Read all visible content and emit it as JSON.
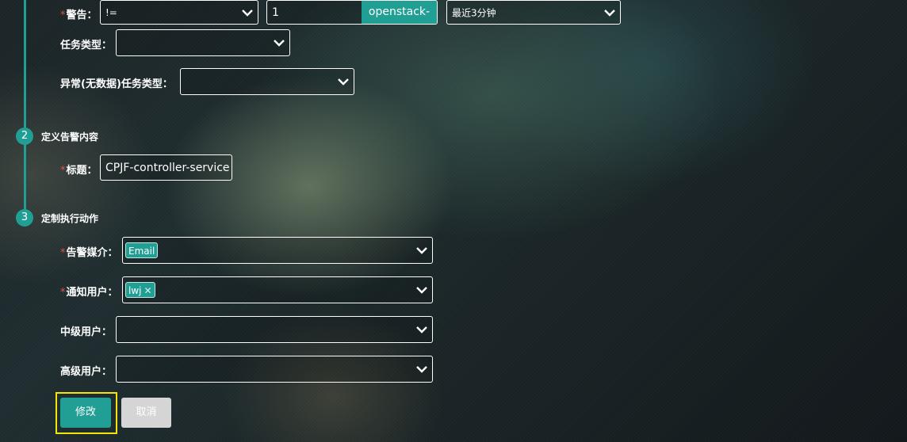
{
  "step1": {
    "alert": {
      "label": "警告：",
      "operator": "!=",
      "threshold": "1",
      "service_tag": "openstack-api",
      "time_range": "最近3分钟"
    },
    "task_type": {
      "label": "任务类型：",
      "value": ""
    },
    "nodata_task_type": {
      "label": "异常(无数据)任务类型：",
      "value": ""
    }
  },
  "step2": {
    "number": "2",
    "title": "定义告警内容",
    "subject": {
      "label": "标题：",
      "value": "CPJF-controller-service"
    }
  },
  "step3": {
    "number": "3",
    "title": "定制执行动作",
    "media": {
      "label": "告警媒介：",
      "tags": [
        "Email"
      ]
    },
    "notify_users": {
      "label": "通知用户：",
      "tags": [
        "lwj"
      ],
      "remove_symbol": "✕"
    },
    "mid_users": {
      "label": "中级用户：",
      "value": ""
    },
    "senior_users": {
      "label": "高级用户：",
      "value": ""
    }
  },
  "required_mark": "*",
  "buttons": {
    "modify": "修改",
    "cancel": "取消"
  },
  "colors": {
    "accent": "#1f9e93",
    "required": "#d9534f",
    "highlight": "#f2e600",
    "cancel": "#d5d5d5"
  }
}
